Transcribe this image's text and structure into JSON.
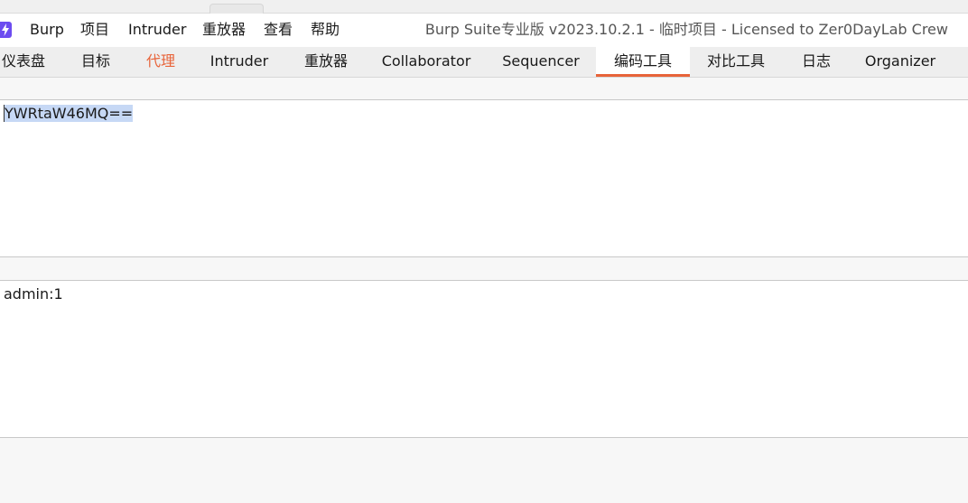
{
  "menubar": {
    "app_icon": "burp-lightning-icon",
    "items": [
      "Burp",
      "项目",
      "Intruder",
      "重放器",
      "查看",
      "帮助"
    ],
    "window_title": "Burp Suite专业版  v2023.10.2.1 - 临时项目 - Licensed to Zer0DayLab Crew"
  },
  "tabs": [
    {
      "label": "仪表盘"
    },
    {
      "label": "目标"
    },
    {
      "label": "代理"
    },
    {
      "label": "Intruder"
    },
    {
      "label": "重放器"
    },
    {
      "label": "Collaborator"
    },
    {
      "label": "Sequencer"
    },
    {
      "label": "编码工具"
    },
    {
      "label": "对比工具"
    },
    {
      "label": "日志"
    },
    {
      "label": "Organizer"
    }
  ],
  "active_tab": "编码工具",
  "highlighted_tab": "代理",
  "colors": {
    "accent": "#e8643a",
    "selection": "#c6d8f5",
    "app_icon": "#6c4cf0"
  },
  "decoder": {
    "input_text": "YWRtaW46MQ==",
    "output_text": "admin:1"
  }
}
